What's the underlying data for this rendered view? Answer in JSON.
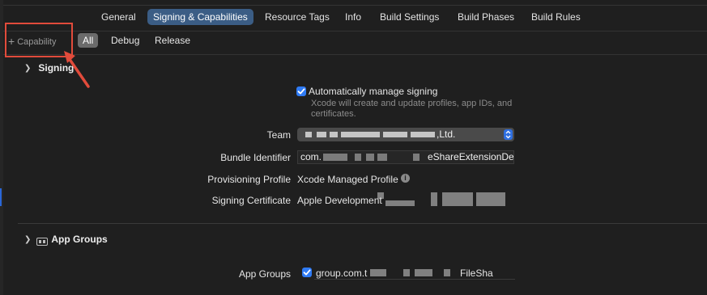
{
  "tabs": [
    {
      "label": "General",
      "active": false
    },
    {
      "label": "Signing & Capabilities",
      "active": true
    },
    {
      "label": "Resource Tags",
      "active": false
    },
    {
      "label": "Info",
      "active": false
    },
    {
      "label": "Build Settings",
      "active": false
    },
    {
      "label": "Build Phases",
      "active": false
    },
    {
      "label": "Build Rules",
      "active": false
    }
  ],
  "toolbar": {
    "capability_label": "Capability",
    "filters": [
      {
        "label": "All",
        "active": true
      },
      {
        "label": "Debug",
        "active": false
      },
      {
        "label": "Release",
        "active": false
      }
    ]
  },
  "signing": {
    "title": "Signing",
    "auto_manage": {
      "label": "Automatically manage signing",
      "checked": true,
      "help": "Xcode will create and update profiles, app IDs, and certificates."
    },
    "rows": {
      "team": {
        "label": "Team",
        "value_visible": ",Ltd."
      },
      "bundle": {
        "label": "Bundle Identifier",
        "value_prefix": "com.",
        "value_suffix": "eShareExtensionDev"
      },
      "profile": {
        "label": "Provisioning Profile",
        "value": "Xcode Managed Profile"
      },
      "certificate": {
        "label": "Signing Certificate",
        "value": "Apple Development"
      }
    }
  },
  "app_groups": {
    "title": "App Groups",
    "row_label": "App Groups",
    "items": [
      {
        "checked": true,
        "value_prefix": "group.com.t",
        "value_suffix": "FileSha"
      }
    ]
  },
  "colors": {
    "accent": "#2f7bf5",
    "active_tab": "#3b5d85",
    "annotation": "#e14b3b",
    "background": "#1f1f1f"
  }
}
